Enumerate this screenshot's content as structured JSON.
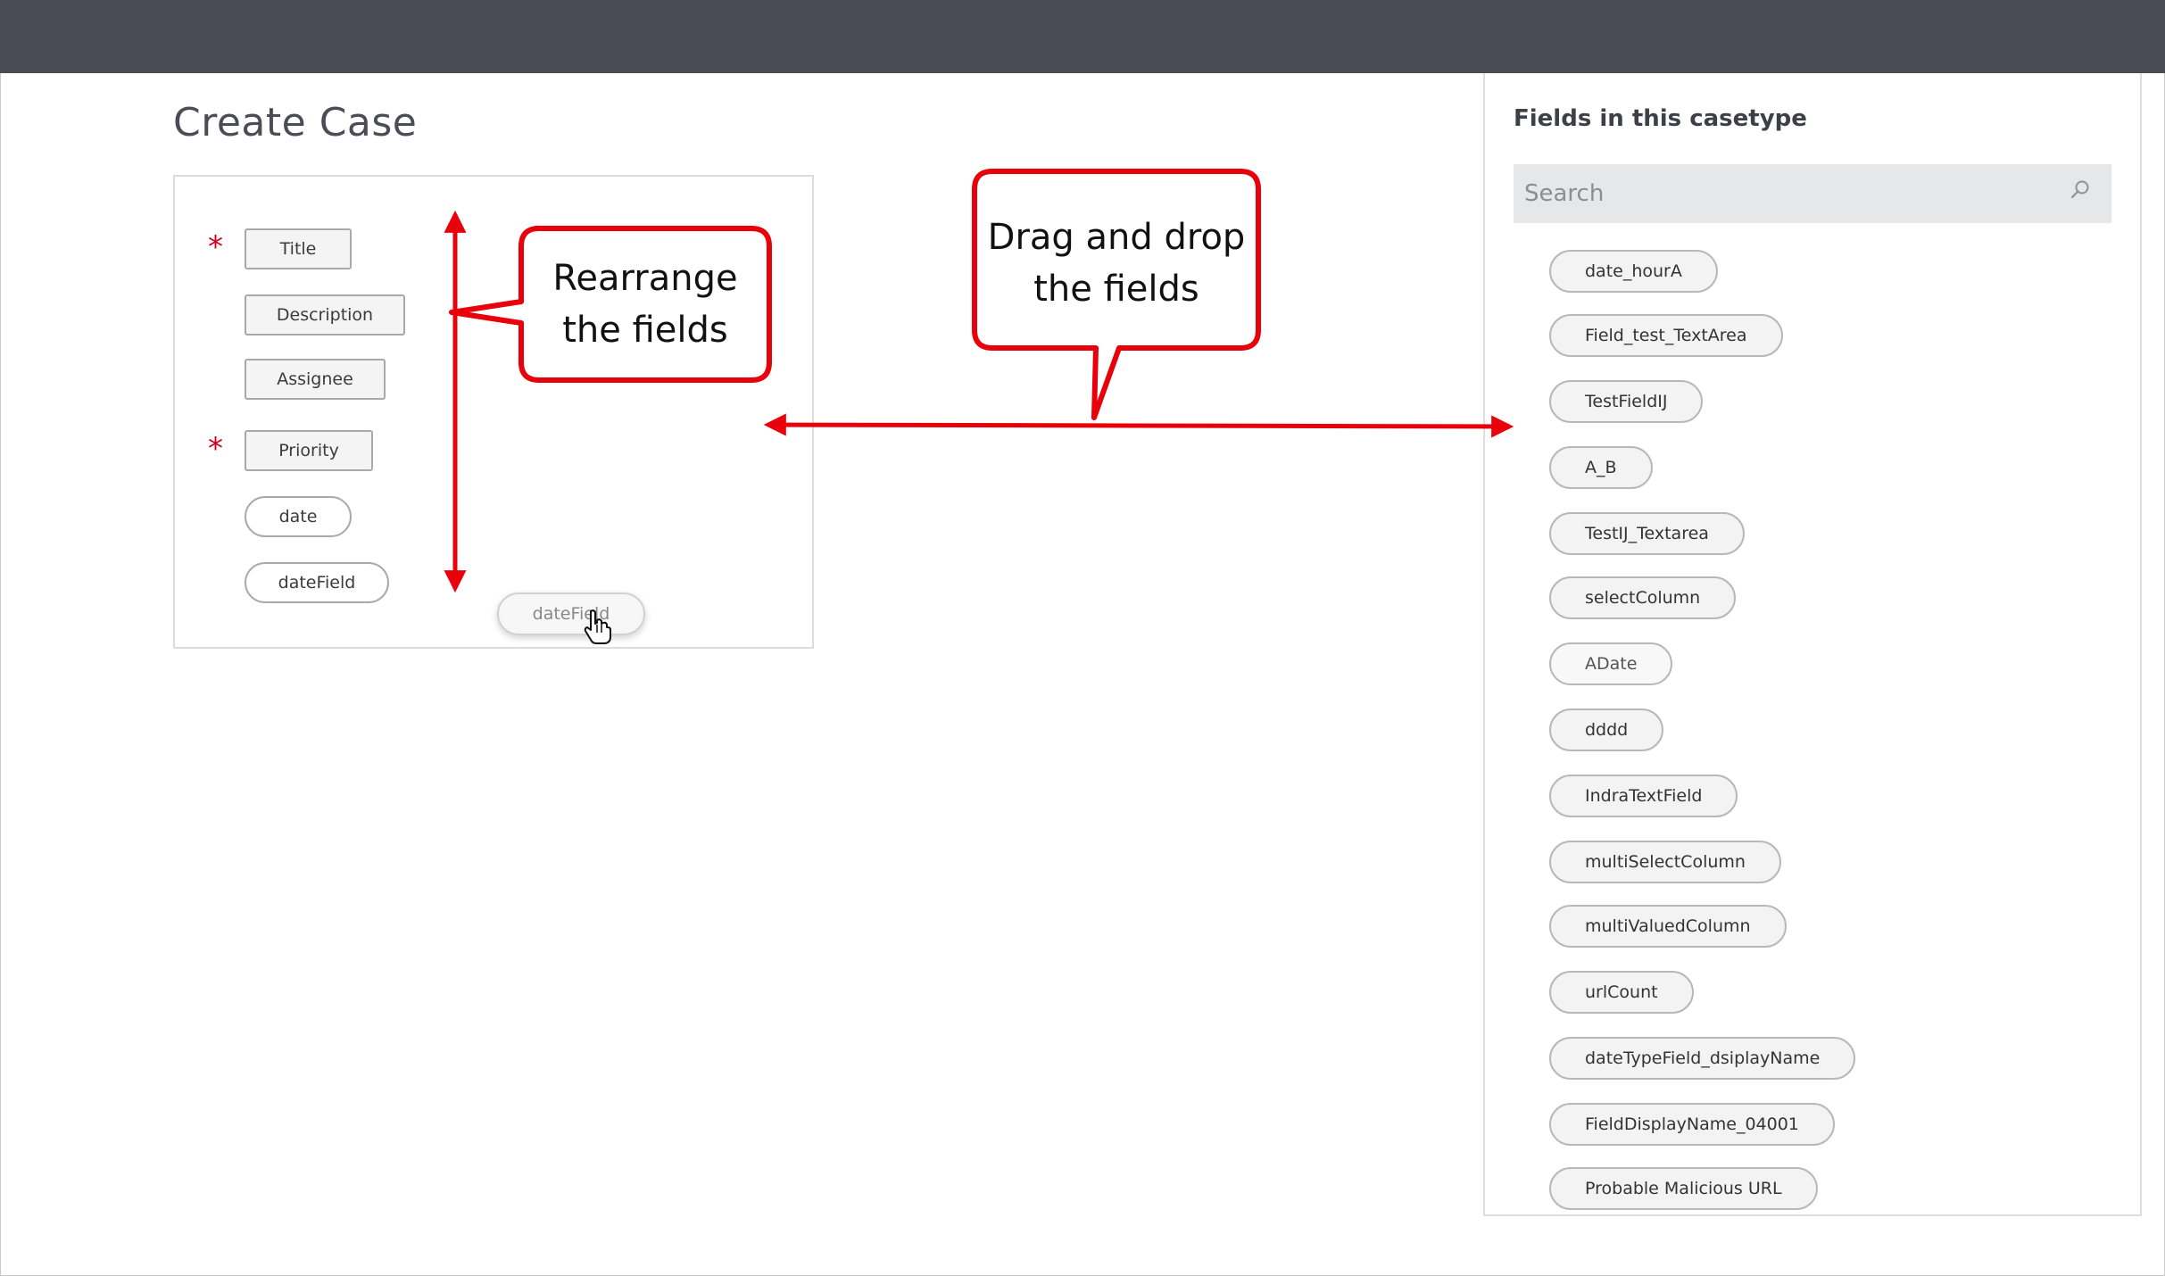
{
  "header": {
    "bar_color": "#494c54"
  },
  "page": {
    "title": "Create Case"
  },
  "form": {
    "fields": [
      {
        "label": "Title",
        "required": true,
        "style": "box"
      },
      {
        "label": "Description",
        "required": false,
        "style": "box"
      },
      {
        "label": "Assignee",
        "required": false,
        "style": "box"
      },
      {
        "label": "Priority",
        "required": true,
        "style": "box"
      },
      {
        "label": "date",
        "required": false,
        "style": "pill"
      },
      {
        "label": "dateField",
        "required": false,
        "style": "pill"
      }
    ],
    "required_marker": "*",
    "dragging_field": "dateField"
  },
  "sidebar": {
    "title": "Fields in this casetype",
    "search_placeholder": "Search",
    "fields": [
      "date_hourA",
      "Field_test_TextArea",
      "TestFieldIJ",
      "A_B",
      "TestIJ_Textarea",
      "selectColumn",
      "ADate",
      "dddd",
      "IndraTextField",
      "multiSelectColumn",
      "multiValuedColumn",
      "urlCount",
      "dateTypeField_dsiplayName",
      "FieldDisplayName_04001",
      "Probable Malicious URL"
    ]
  },
  "annotations": {
    "rearrange_line1": "Rearrange",
    "rearrange_line2": "the fields",
    "drag_line1": "Drag and drop",
    "drag_line2": "the fields",
    "annotation_color": "#e8000b"
  }
}
